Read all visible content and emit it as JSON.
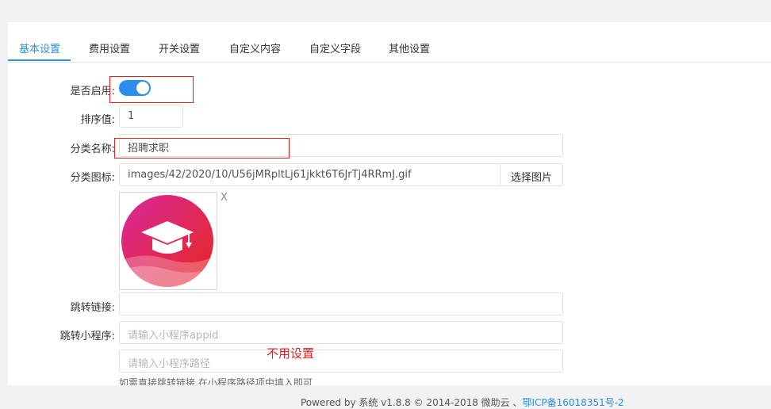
{
  "tabs": [
    {
      "label": "基本设置",
      "active": true
    },
    {
      "label": "费用设置"
    },
    {
      "label": "开关设置"
    },
    {
      "label": "自定义内容"
    },
    {
      "label": "自定义字段"
    },
    {
      "label": "其他设置"
    }
  ],
  "form": {
    "enabled_label": "是否启用:",
    "enabled": true,
    "sort_label": "排序值:",
    "sort_value": "1",
    "name_label": "分类名称:",
    "name_value": "招聘求职",
    "icon_label": "分类图标:",
    "icon_value": "images/42/2020/10/U56jMRpltLj61jkkt6T6JrTj4RRmJ.gif",
    "select_image_button": "选择图片",
    "remove_icon": "X",
    "link_label": "跳转链接:",
    "link_value": "",
    "miniprogram_label": "跳转小程序:",
    "appid_placeholder": "请输入小程序appid",
    "path_placeholder": "请输入小程序路径",
    "help_text": "如需直接跳转链接,在小程序路径项中填入即可"
  },
  "annotation": "不用设置",
  "footer": {
    "text": "Powered by 系统 v1.8.8 © 2014-2018 微助云 、",
    "icp_link": "鄂ICP备16018351号-2"
  },
  "colors": {
    "accent": "#2b90d9",
    "switch_on": "#2d8cf0",
    "annotation_red": "#e02020",
    "icon_gradient_start": "#d8289b",
    "icon_gradient_end": "#e8281e"
  },
  "icons": {
    "category_icon": "graduation-cap-icon"
  }
}
